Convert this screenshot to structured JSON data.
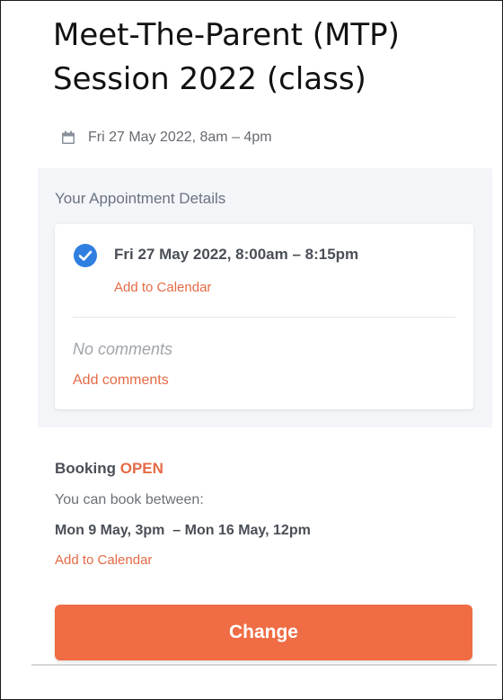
{
  "event": {
    "title_line1": "Meet-The-Parent (MTP)",
    "title_line2": "Session 2022 (class)",
    "date_range": "Fri 27 May 2022, 8am – 4pm"
  },
  "appointment": {
    "heading": "Your Appointment Details",
    "time": "Fri 27 May 2022, 8:00am – 8:15pm",
    "add_to_calendar": "Add to Calendar",
    "comments_placeholder": "No comments",
    "add_comments": "Add comments"
  },
  "booking": {
    "label": "Booking",
    "status": "OPEN",
    "between_label": "You can book between:",
    "range": "Mon 9 May, 3pm  – Mon 16 May, 12pm",
    "add_to_calendar": "Add to Calendar"
  },
  "actions": {
    "change_label": "Change"
  },
  "icons": {
    "event_date": "calendar-icon",
    "appointment_status": "check-circle-icon"
  },
  "colors": {
    "accent": "#ef6c44",
    "link": "#e56a45",
    "check": "#2f7fe0",
    "section_bg": "#f3f5f9"
  }
}
